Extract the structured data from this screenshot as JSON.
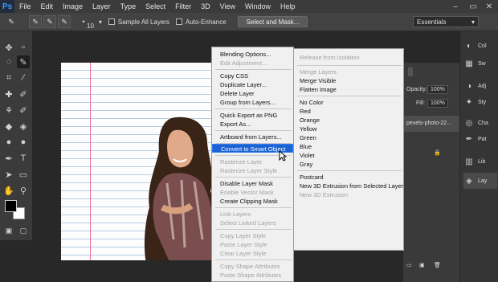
{
  "app": {
    "logo": "Ps"
  },
  "menubar": {
    "items": [
      "File",
      "Edit",
      "Image",
      "Layer",
      "Type",
      "Select",
      "Filter",
      "3D",
      "View",
      "Window",
      "Help"
    ],
    "minimize": "–",
    "restore": "▭",
    "close": "✕"
  },
  "options": {
    "brush_size": "10",
    "sample_all_layers": "Sample All Layers",
    "auto_enhance": "Auto-Enhance",
    "select_and_mask": "Select and Mask...",
    "workspace": "Essentials"
  },
  "layers_panel": {
    "opacity_label": "Opacity:",
    "opacity_value": "100%",
    "fill_label": "Fill:",
    "fill_value": "100%",
    "layer_name": "pexels-photo-22..."
  },
  "dock": {
    "items": [
      "Col",
      "Sw",
      "Adj",
      "Sty",
      "Cha",
      "Pat",
      "Lib",
      "Lay"
    ]
  },
  "context_menu": {
    "items": [
      {
        "label": "Blending Options...",
        "disabled": false
      },
      {
        "label": "Edit Adjustment...",
        "disabled": true
      },
      {
        "label": "Copy CSS",
        "disabled": false
      },
      {
        "label": "Duplicate Layer...",
        "disabled": false
      },
      {
        "label": "Delete Layer",
        "disabled": false
      },
      {
        "label": "Group from Layers...",
        "disabled": false
      },
      {
        "label": "Quick Export as PNG",
        "disabled": false
      },
      {
        "label": "Export As...",
        "disabled": false
      },
      {
        "label": "Artboard from Layers...",
        "disabled": false
      },
      {
        "label": "Convert to Smart Object",
        "disabled": false
      },
      {
        "label": "Rasterize Layer",
        "disabled": true
      },
      {
        "label": "Rasterize Layer Style",
        "disabled": true
      },
      {
        "label": "Disable Layer Mask",
        "disabled": false
      },
      {
        "label": "Enable Vector Mask",
        "disabled": true
      },
      {
        "label": "Create Clipping Mask",
        "disabled": false
      },
      {
        "label": "Link Layers",
        "disabled": true
      },
      {
        "label": "Select Linked Layers",
        "disabled": true
      },
      {
        "label": "Copy Layer Style",
        "disabled": true
      },
      {
        "label": "Paste Layer Style",
        "disabled": true
      },
      {
        "label": "Clear Layer Style",
        "disabled": true
      },
      {
        "label": "Copy Shape Attributes",
        "disabled": true
      },
      {
        "label": "Paste Shape Attributes",
        "disabled": true
      }
    ],
    "highlighted": "Convert to Smart Object"
  },
  "context_menu_2": {
    "items": [
      {
        "label": "Release from Isolation",
        "disabled": true
      },
      {
        "label": "Merge Layers",
        "disabled": true
      },
      {
        "label": "Merge Visible",
        "disabled": false
      },
      {
        "label": "Flatten Image",
        "disabled": false
      },
      {
        "label": "No Color",
        "disabled": false
      },
      {
        "label": "Red",
        "disabled": false
      },
      {
        "label": "Orange",
        "disabled": false
      },
      {
        "label": "Yellow",
        "disabled": false
      },
      {
        "label": "Green",
        "disabled": false
      },
      {
        "label": "Blue",
        "disabled": false
      },
      {
        "label": "Violet",
        "disabled": false
      },
      {
        "label": "Gray",
        "disabled": false
      },
      {
        "label": "Postcard",
        "disabled": false
      },
      {
        "label": "New 3D Extrusion from Selected Layer",
        "disabled": false
      },
      {
        "label": "New 3D Extrusion",
        "disabled": true
      }
    ]
  }
}
